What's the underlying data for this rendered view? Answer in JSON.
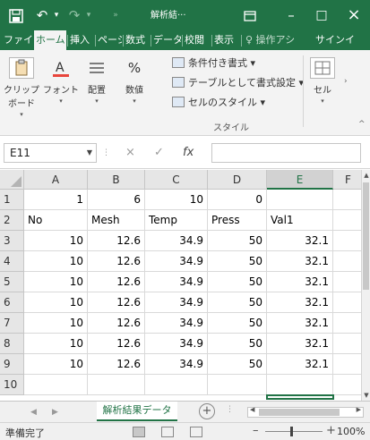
{
  "titlebar": {
    "save_icon": "save-icon",
    "undo_icon": "undo-icon",
    "redo_icon": "redo-icon",
    "title": "解析結",
    "title_suffix": "···",
    "ribbon_display_icon": "ribbon-display-icon",
    "minimize": "–",
    "maximize": "□",
    "close": "×"
  },
  "tabs": [
    "ファイル",
    "ホーム",
    "挿入",
    "ページ",
    "数式",
    "データ",
    "校閲",
    "表示",
    "♀ 操作アシ",
    "サインイ"
  ],
  "active_tab": 1,
  "ribbon": {
    "clipboard": "クリップボード",
    "font": "フォント",
    "alignment": "配置",
    "number": "数値",
    "conditional_format": "条件付き書式",
    "format_as_table": "テーブルとして書式設定",
    "cell_styles": "セルのスタイル",
    "styles_group": "スタイル",
    "cells": "セル"
  },
  "formula_bar": {
    "name_box": "E11",
    "cancel": "×",
    "enter": "✓",
    "fx": "fx",
    "value": ""
  },
  "sheet": {
    "columns": [
      "A",
      "B",
      "C",
      "D",
      "E",
      "F"
    ],
    "selected_column": "E",
    "rows": [
      {
        "num": "1",
        "cells": [
          "1",
          "6",
          "10",
          "0",
          "",
          ""
        ]
      },
      {
        "num": "2",
        "cells": [
          "No",
          "Mesh",
          "Temp",
          "Press",
          "Val1",
          ""
        ]
      },
      {
        "num": "3",
        "cells": [
          "10",
          "12.6",
          "34.9",
          "50",
          "32.1",
          ""
        ]
      },
      {
        "num": "4",
        "cells": [
          "10",
          "12.6",
          "34.9",
          "50",
          "32.1",
          ""
        ]
      },
      {
        "num": "5",
        "cells": [
          "10",
          "12.6",
          "34.9",
          "50",
          "32.1",
          ""
        ]
      },
      {
        "num": "6",
        "cells": [
          "10",
          "12.6",
          "34.9",
          "50",
          "32.1",
          ""
        ]
      },
      {
        "num": "7",
        "cells": [
          "10",
          "12.6",
          "34.9",
          "50",
          "32.1",
          ""
        ]
      },
      {
        "num": "8",
        "cells": [
          "10",
          "12.6",
          "34.9",
          "50",
          "32.1",
          ""
        ]
      },
      {
        "num": "9",
        "cells": [
          "10",
          "12.6",
          "34.9",
          "50",
          "32.1",
          ""
        ]
      },
      {
        "num": "10",
        "cells": [
          "",
          "",
          "",
          "",
          "",
          ""
        ]
      }
    ]
  },
  "sheet_tab": "解析結果データ",
  "status": {
    "text": "準備完了",
    "zoom": "100%"
  },
  "colors": {
    "accent": "#217346"
  }
}
